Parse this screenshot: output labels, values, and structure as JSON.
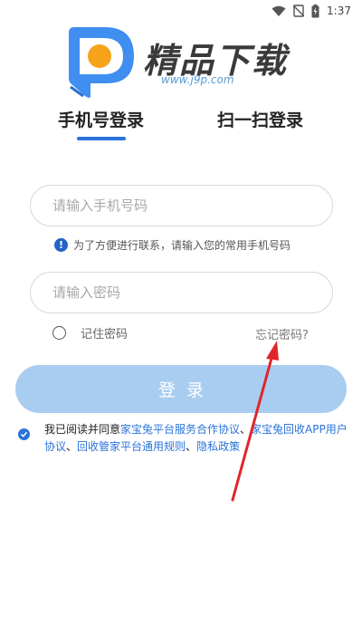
{
  "status": {
    "time": "1:37"
  },
  "logo": {
    "text": "精品下载",
    "url": "www.j9p.com"
  },
  "tabs": [
    {
      "label": "手机号登录",
      "active": true
    },
    {
      "label": "扫一扫登录",
      "active": false
    }
  ],
  "form": {
    "phone_placeholder": "请输入手机号码",
    "phone_hint": "为了方便进行联系，请输入您的常用手机号码",
    "password_placeholder": "请输入密码",
    "remember_label": "记住密码",
    "forgot_label": "忘记密码?",
    "login_label": "登录"
  },
  "agreement": {
    "prefix": "我已阅读并同意",
    "link1": "家宝兔平台服务合作协议",
    "sep1": "、",
    "link2": "家宝兔回收APP用户协议",
    "sep2": "、",
    "link3": "回收管家平台通用规则",
    "sep3": "、",
    "link4": "隐私政策"
  },
  "colors": {
    "accent": "#2a73d9",
    "button": "#a8cdf0",
    "arrow": "#e0262b"
  }
}
